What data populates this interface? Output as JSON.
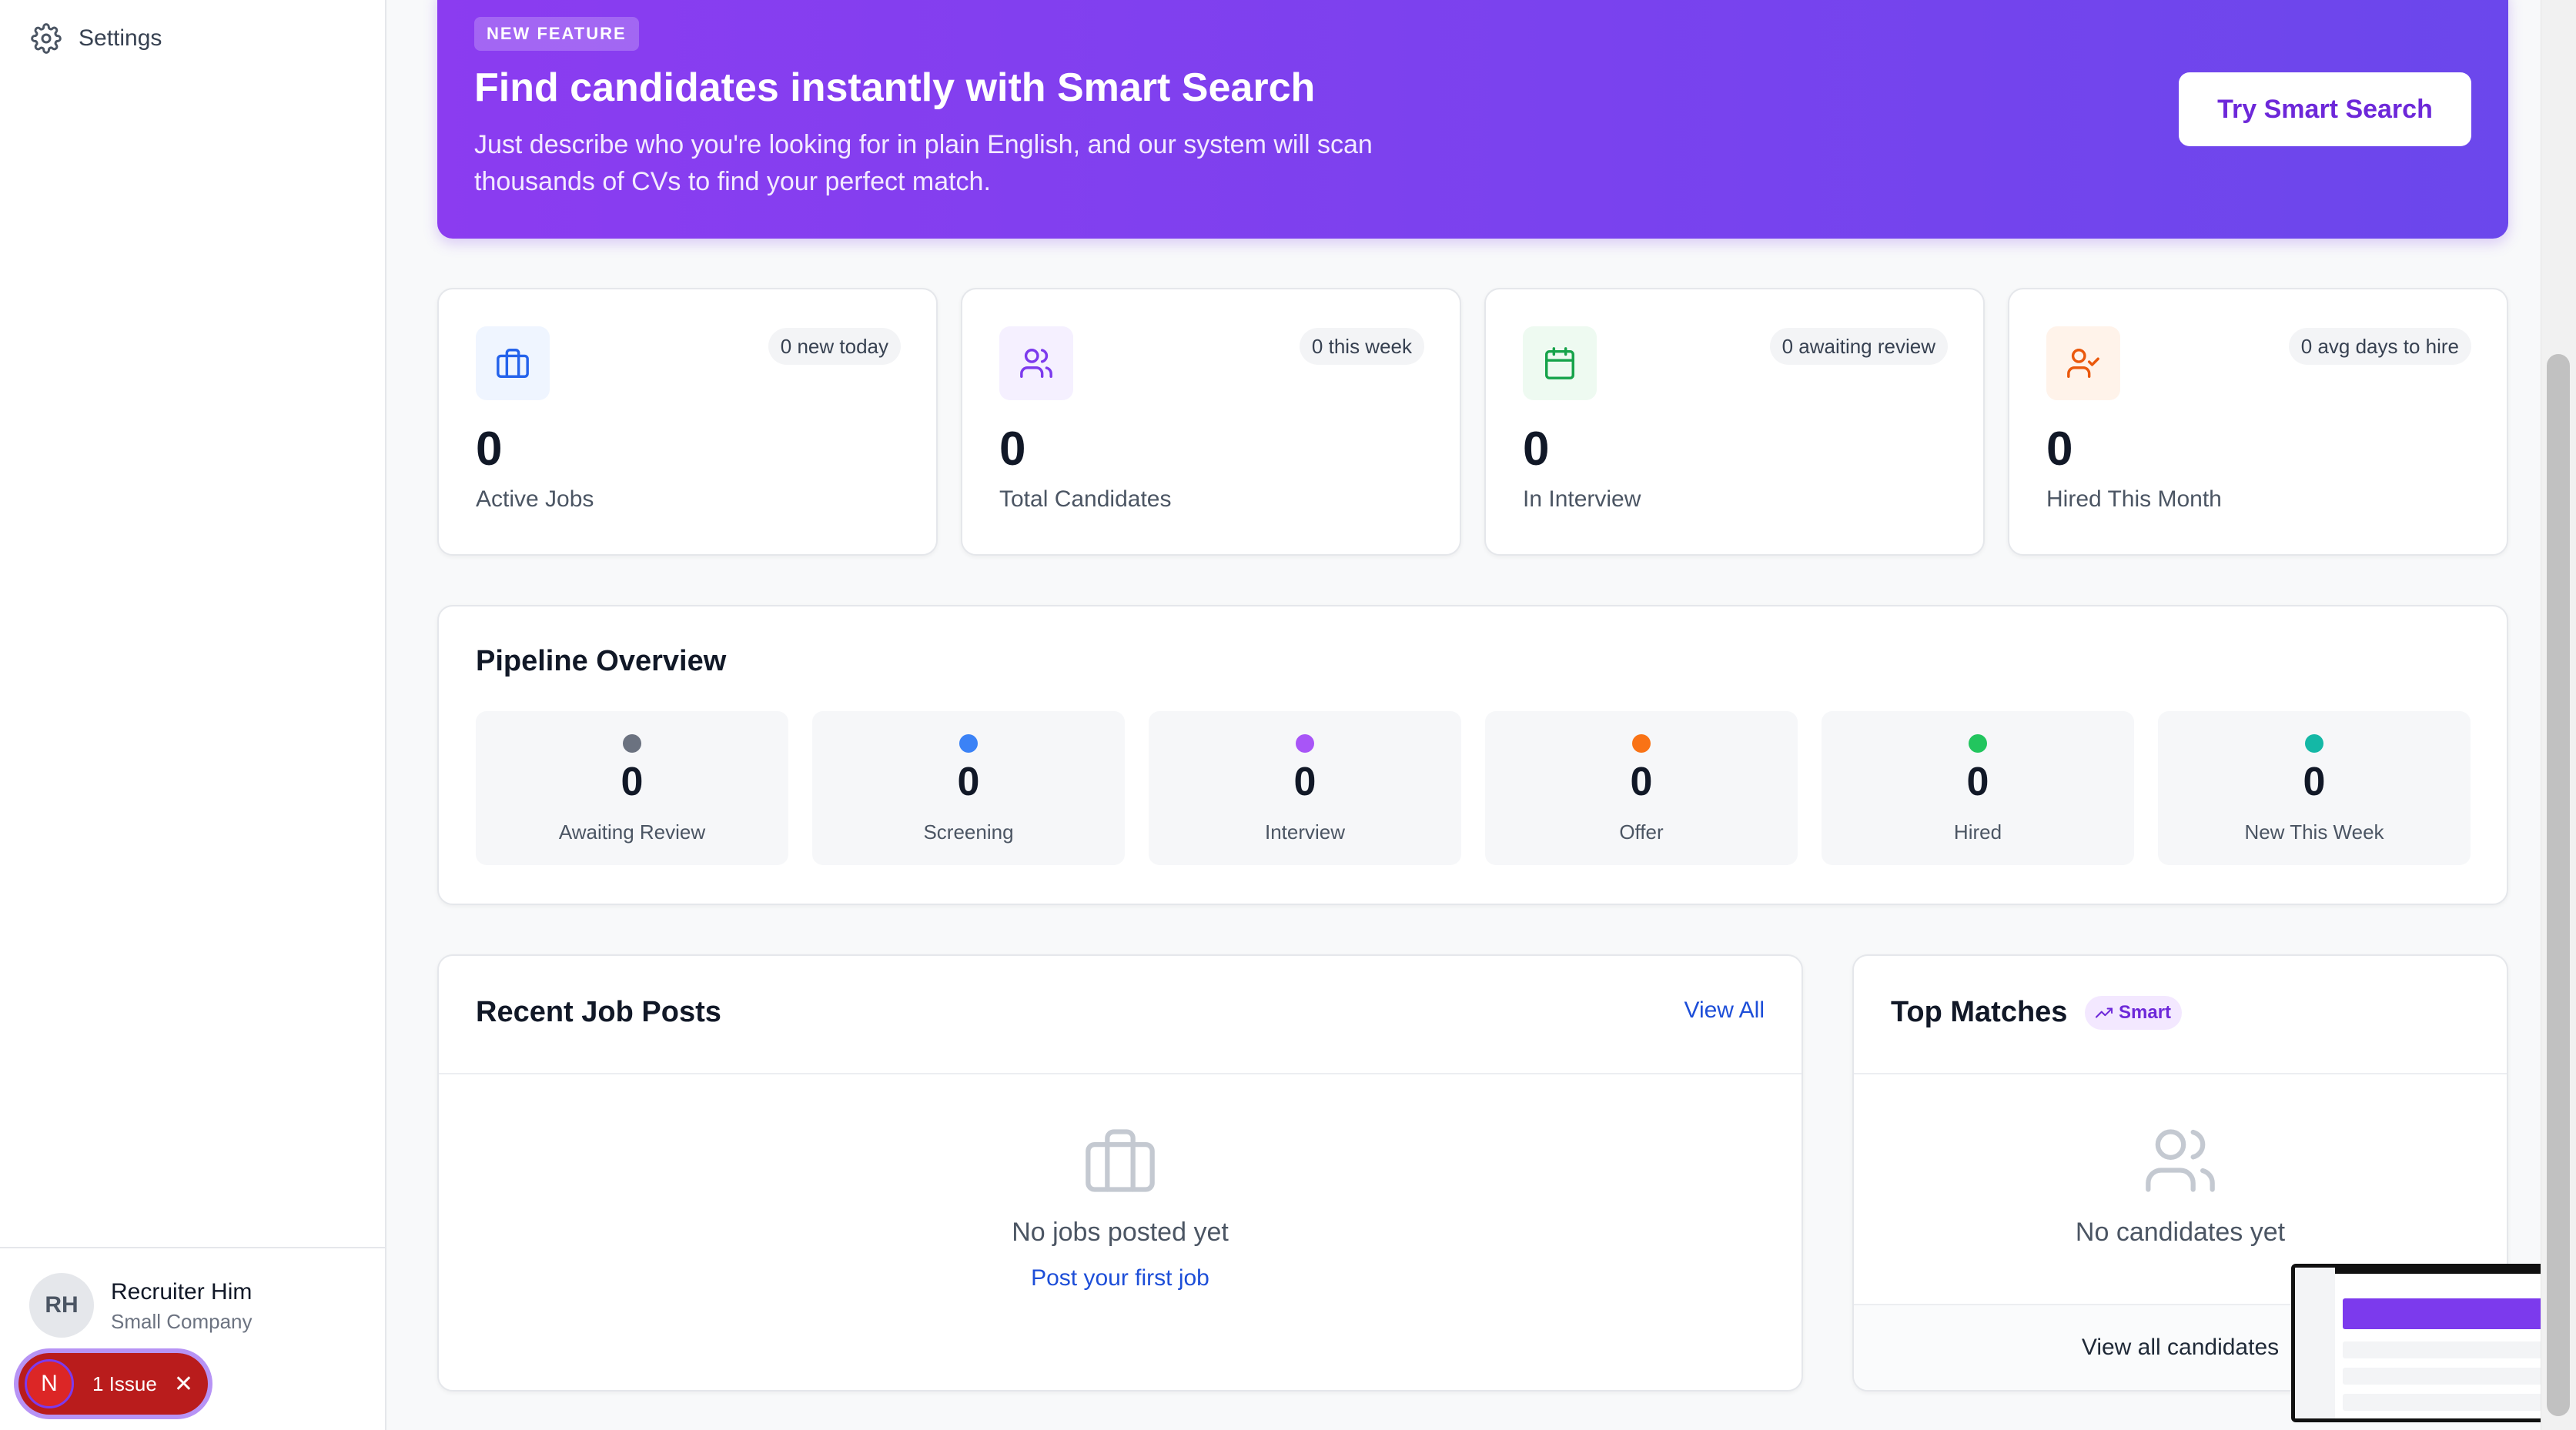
{
  "sidebar": {
    "settings_label": "Settings",
    "user": {
      "initials": "RH",
      "name": "Recruiter Him",
      "company": "Small Company"
    },
    "issue": {
      "letter": "N",
      "label": "1 Issue"
    }
  },
  "banner": {
    "badge": "NEW FEATURE",
    "title": "Find candidates instantly with Smart Search",
    "description": "Just describe who you're looking for in plain English, and our system will scan thousands of CVs to find your perfect match.",
    "button": "Try Smart Search"
  },
  "stats": [
    {
      "value": "0",
      "label": "Active Jobs",
      "pill": "0 new today",
      "icon": "briefcase-icon",
      "color": "#2563eb",
      "bg": "#eff5ff"
    },
    {
      "value": "0",
      "label": "Total Candidates",
      "pill": "0 this week",
      "icon": "users-icon",
      "color": "#7c3aed",
      "bg": "#f5f0ff"
    },
    {
      "value": "0",
      "label": "In Interview",
      "pill": "0 awaiting review",
      "icon": "calendar-icon",
      "color": "#16a34a",
      "bg": "#eefaf1"
    },
    {
      "value": "0",
      "label": "Hired This Month",
      "pill": "0 avg days to hire",
      "icon": "user-check-icon",
      "color": "#ea580c",
      "bg": "#fff3ea"
    }
  ],
  "pipeline": {
    "title": "Pipeline Overview",
    "stages": [
      {
        "value": "0",
        "label": "Awaiting Review",
        "color": "#6b7280"
      },
      {
        "value": "0",
        "label": "Screening",
        "color": "#3b82f6"
      },
      {
        "value": "0",
        "label": "Interview",
        "color": "#a855f7"
      },
      {
        "value": "0",
        "label": "Offer",
        "color": "#f97316"
      },
      {
        "value": "0",
        "label": "Hired",
        "color": "#22c55e"
      },
      {
        "value": "0",
        "label": "New This Week",
        "color": "#14b8a6"
      }
    ]
  },
  "jobs": {
    "title": "Recent Job Posts",
    "view_all": "View All",
    "empty": "No jobs posted yet",
    "cta": "Post your first job"
  },
  "matches": {
    "title": "Top Matches",
    "badge": "Smart",
    "empty": "No candidates yet",
    "footer_link": "View all candidates"
  }
}
